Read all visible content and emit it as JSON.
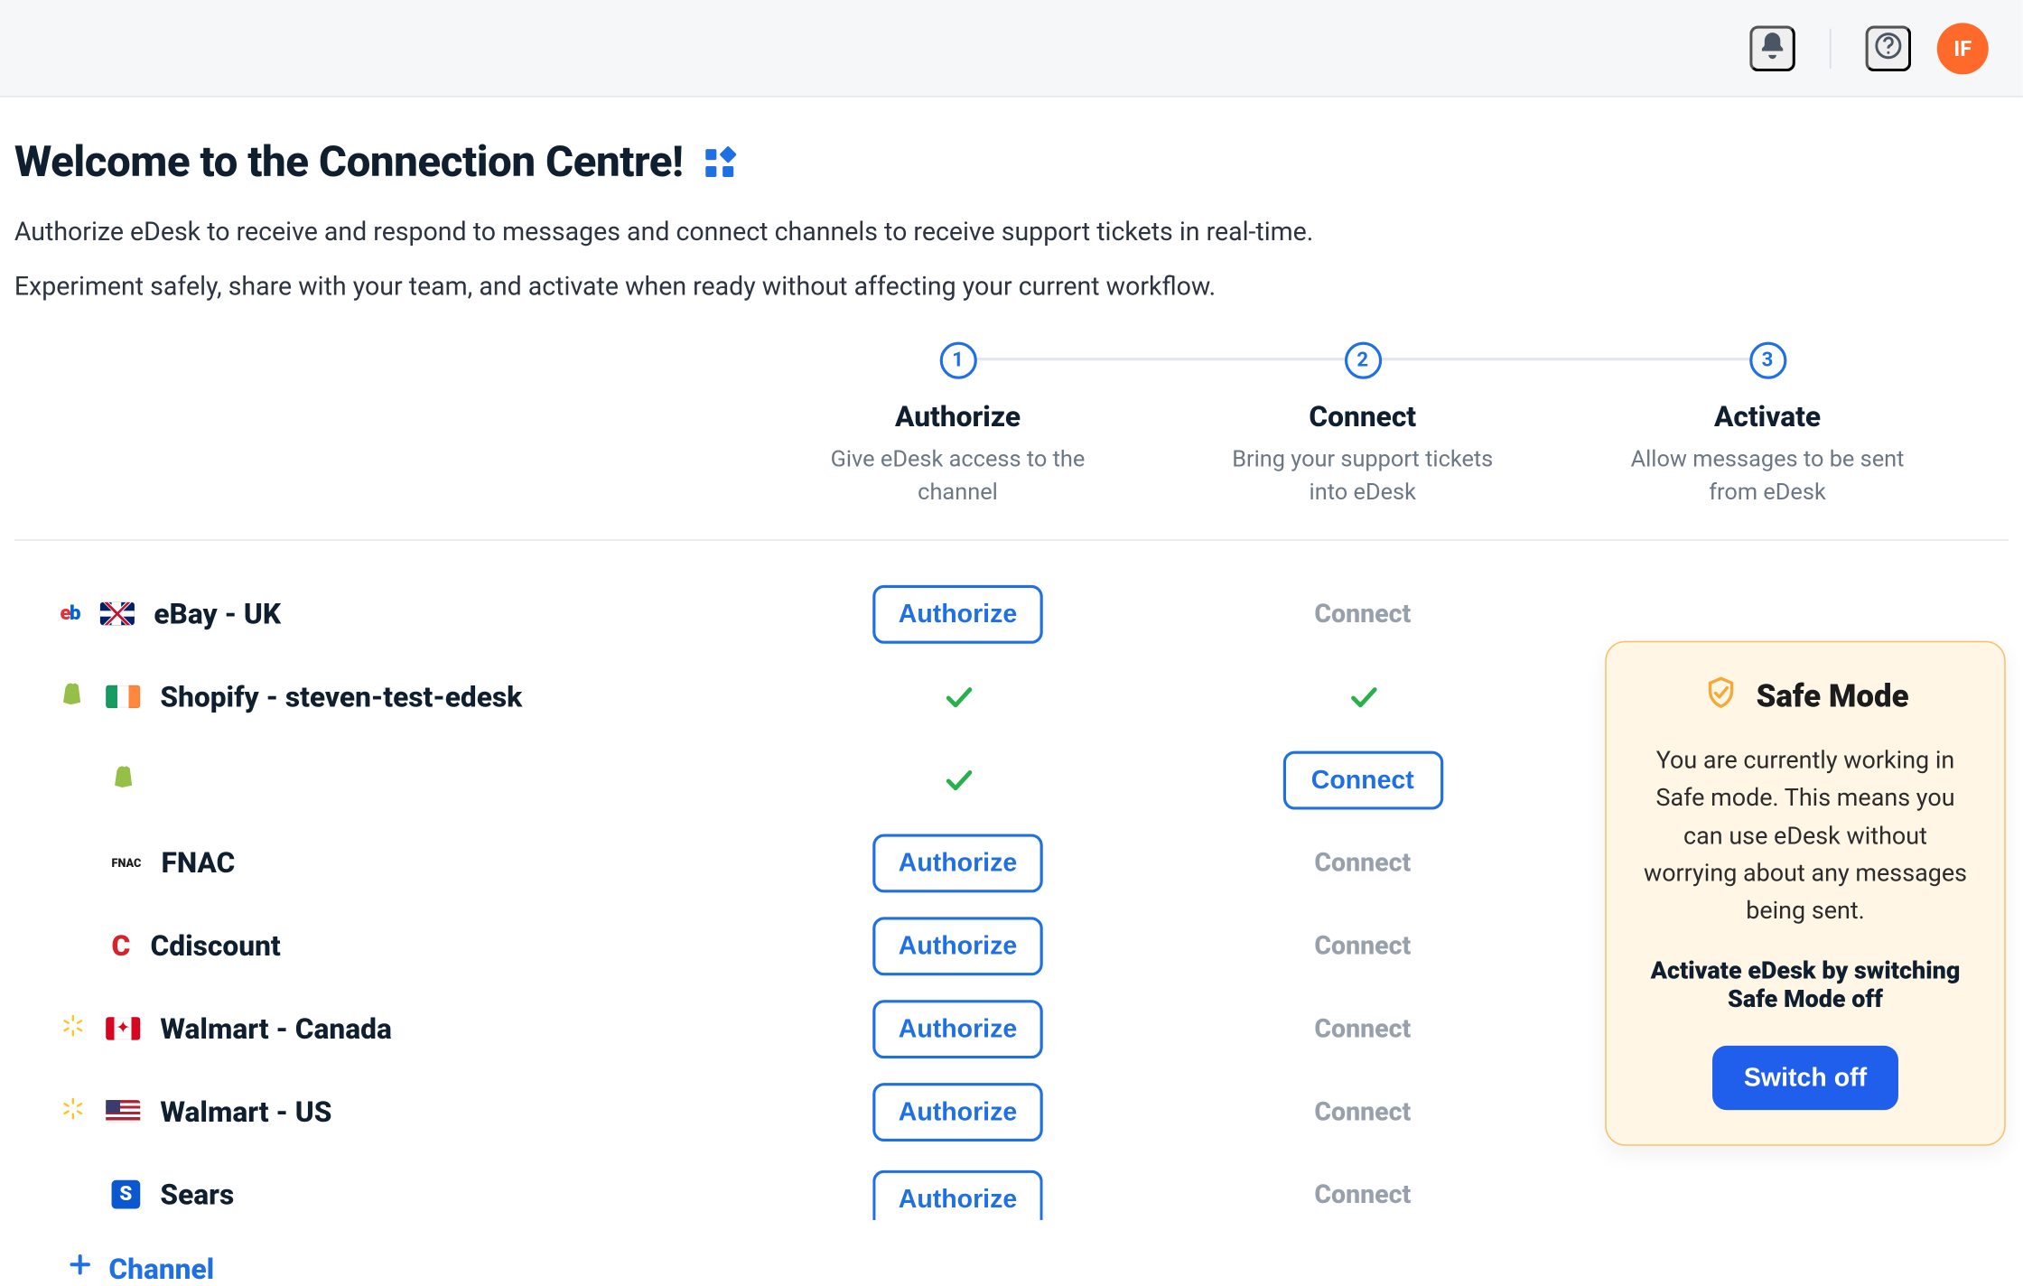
{
  "topbar": {
    "avatar_initials": "IF"
  },
  "header": {
    "title": "Welcome to the Connection Centre!",
    "lead_line1": "Authorize eDesk to receive and respond to messages and connect channels to receive support tickets in real-time.",
    "lead_line2": "Experiment safely, share with your team, and activate when ready without affecting your current workflow."
  },
  "steps": [
    {
      "num": "1",
      "title": "Authorize",
      "desc": "Give eDesk access to the channel"
    },
    {
      "num": "2",
      "title": "Connect",
      "desc": "Bring your support tickets into eDesk"
    },
    {
      "num": "3",
      "title": "Activate",
      "desc": "Allow messages to be sent from eDesk"
    }
  ],
  "labels": {
    "authorize": "Authorize",
    "connect": "Connect",
    "add_channel": "Channel"
  },
  "rows": [
    {
      "name": "eBay - UK",
      "authorize": "btn",
      "connect": "muted"
    },
    {
      "name": "Shopify - steven-test-edesk",
      "authorize": "check",
      "connect": "check"
    },
    {
      "name": "",
      "authorize": "check",
      "connect": "btn"
    },
    {
      "name": "FNAC",
      "authorize": "btn",
      "connect": "muted"
    },
    {
      "name": "Cdiscount",
      "authorize": "btn",
      "connect": "muted"
    },
    {
      "name": "Walmart - Canada",
      "authorize": "btn",
      "connect": "muted"
    },
    {
      "name": "Walmart - US",
      "authorize": "btn",
      "connect": "muted"
    },
    {
      "name": "Sears",
      "authorize": "btn",
      "connect": "muted"
    }
  ],
  "safe_mode": {
    "title": "Safe Mode",
    "body": "You are currently working in Safe mode. This means you can use eDesk without worrying about any messages being sent.",
    "cta": "Activate eDesk by switching Safe Mode off",
    "button": "Switch off"
  }
}
